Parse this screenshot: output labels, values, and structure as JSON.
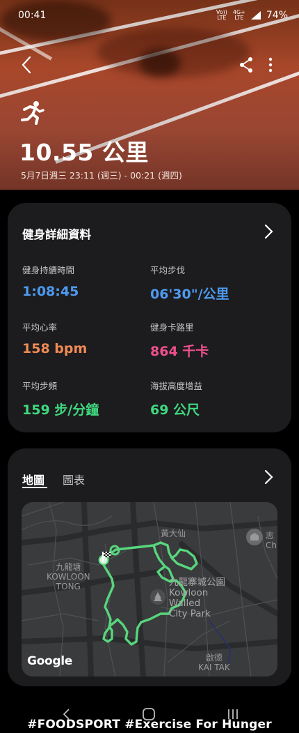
{
  "status_bar": {
    "time": "00:41",
    "net_1": "Vo))",
    "net_1_sub": "LTE",
    "net_2": "4G+",
    "net_2_sub": "LTE",
    "battery": "74%"
  },
  "header": {
    "distance": "10.55 公里",
    "date_range": "5月7日週三 23:11 (週三) - 00:21 (週四)"
  },
  "details": {
    "title": "健身詳細資料",
    "metrics": [
      {
        "label": "健身持續時間",
        "value": "1:08:45",
        "color": "#4e9bf0"
      },
      {
        "label": "平均步伐",
        "value": "06'30\"/公里",
        "color": "#4e9bf0"
      },
      {
        "label": "平均心率",
        "value": "158 bpm",
        "color": "#f18a55"
      },
      {
        "label": "健身卡路里",
        "value": "864 千卡",
        "color": "#f0508e"
      },
      {
        "label": "平均步頻",
        "value": "159 步/分鐘",
        "color": "#3fd97f"
      },
      {
        "label": "海拔高度增益",
        "value": "69 公尺",
        "color": "#3fd97f"
      }
    ]
  },
  "map_card": {
    "tabs": [
      {
        "label": "地圖",
        "active": true
      },
      {
        "label": "圖表",
        "active": false
      }
    ],
    "labels": {
      "wong_tai_sin": "黃大仙",
      "kowloon_tong_zh": "九龍塘",
      "kowloon_tong_en_1": "KOWLOON",
      "kowloon_tong_en_2": "TONG",
      "park_zh": "九龍寨城公園",
      "park_en_1": "Kowloon",
      "park_en_2": "Walled",
      "park_en_3": "City Park",
      "kai_tak_zh": "啟德",
      "kai_tak_en": "KAI TAK",
      "chi_zh": "志",
      "chi_en": "Chi"
    },
    "attribution": "Google",
    "route_color": "#57d67d"
  },
  "watermark": "#FOODSPORT  #Exercise  For Hunger"
}
